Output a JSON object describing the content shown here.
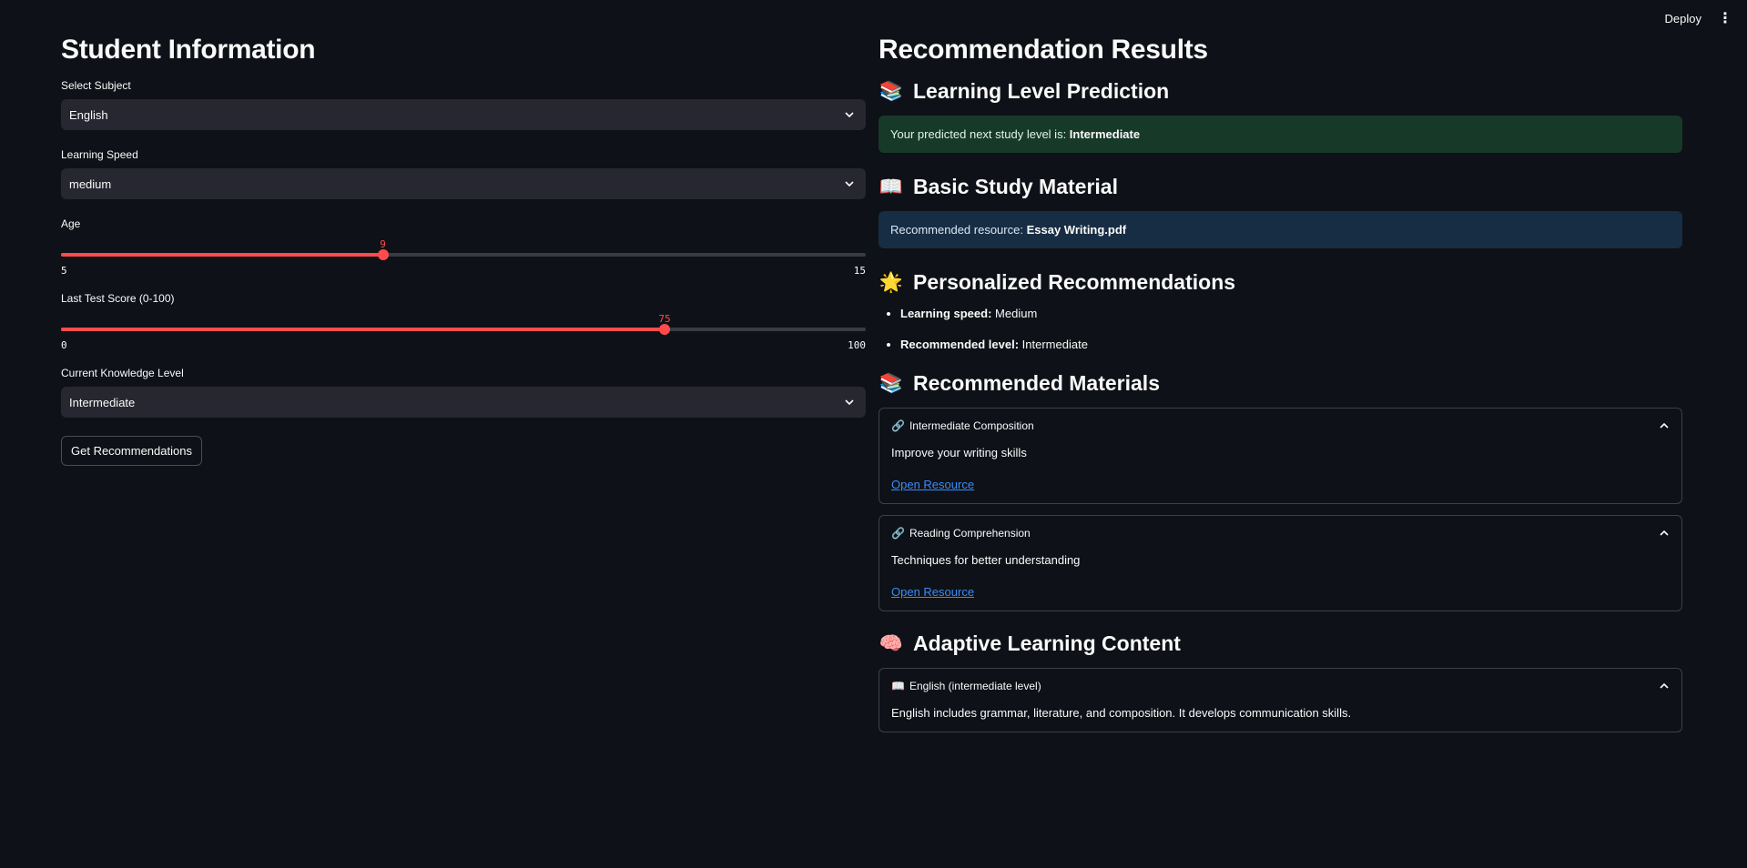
{
  "topbar": {
    "deploy_label": "Deploy",
    "menu_icon": "⋮"
  },
  "left": {
    "title": "Student Information",
    "subject": {
      "label": "Select Subject",
      "value": "English"
    },
    "speed": {
      "label": "Learning Speed",
      "value": "medium"
    },
    "age": {
      "label": "Age",
      "value": "9",
      "min": "5",
      "max": "15",
      "fraction": 0.4
    },
    "score": {
      "label": "Last Test Score (0-100)",
      "value": "75",
      "min": "0",
      "max": "100",
      "fraction": 0.75
    },
    "knowledge": {
      "label": "Current Knowledge Level",
      "value": "Intermediate"
    },
    "button_label": "Get Recommendations"
  },
  "right": {
    "title": "Recommendation Results",
    "prediction": {
      "icon": "📚",
      "heading": "Learning Level Prediction",
      "text": "Your predicted next study level is: ",
      "value": "Intermediate"
    },
    "basic": {
      "icon": "📖",
      "heading": "Basic Study Material",
      "text": "Recommended resource: ",
      "value": "Essay Writing.pdf"
    },
    "personalized": {
      "icon": "🌟",
      "heading": "Personalized Recommendations",
      "items": [
        {
          "label": "Learning speed:",
          "value": " Medium"
        },
        {
          "label": "Recommended level:",
          "value": " Intermediate"
        }
      ]
    },
    "materials": {
      "icon": "📚",
      "heading": "Recommended Materials",
      "items": [
        {
          "icon": "🔗",
          "title": "Intermediate Composition",
          "desc": "Improve your writing skills",
          "link": "Open Resource"
        },
        {
          "icon": "🔗",
          "title": "Reading Comprehension",
          "desc": "Techniques for better understanding",
          "link": "Open Resource"
        }
      ]
    },
    "adaptive": {
      "icon": "🧠",
      "heading": "Adaptive Learning Content",
      "item": {
        "icon": "📖",
        "title": "English (intermediate level)",
        "desc": "English includes grammar, literature, and composition. It develops communication skills."
      }
    }
  },
  "colors": {
    "accent": "#ff4b4b",
    "background": "#0e1117",
    "input_bg": "#262730",
    "success_bg": "#173928",
    "info_bg": "#172d43",
    "link": "#3b8cf5"
  }
}
